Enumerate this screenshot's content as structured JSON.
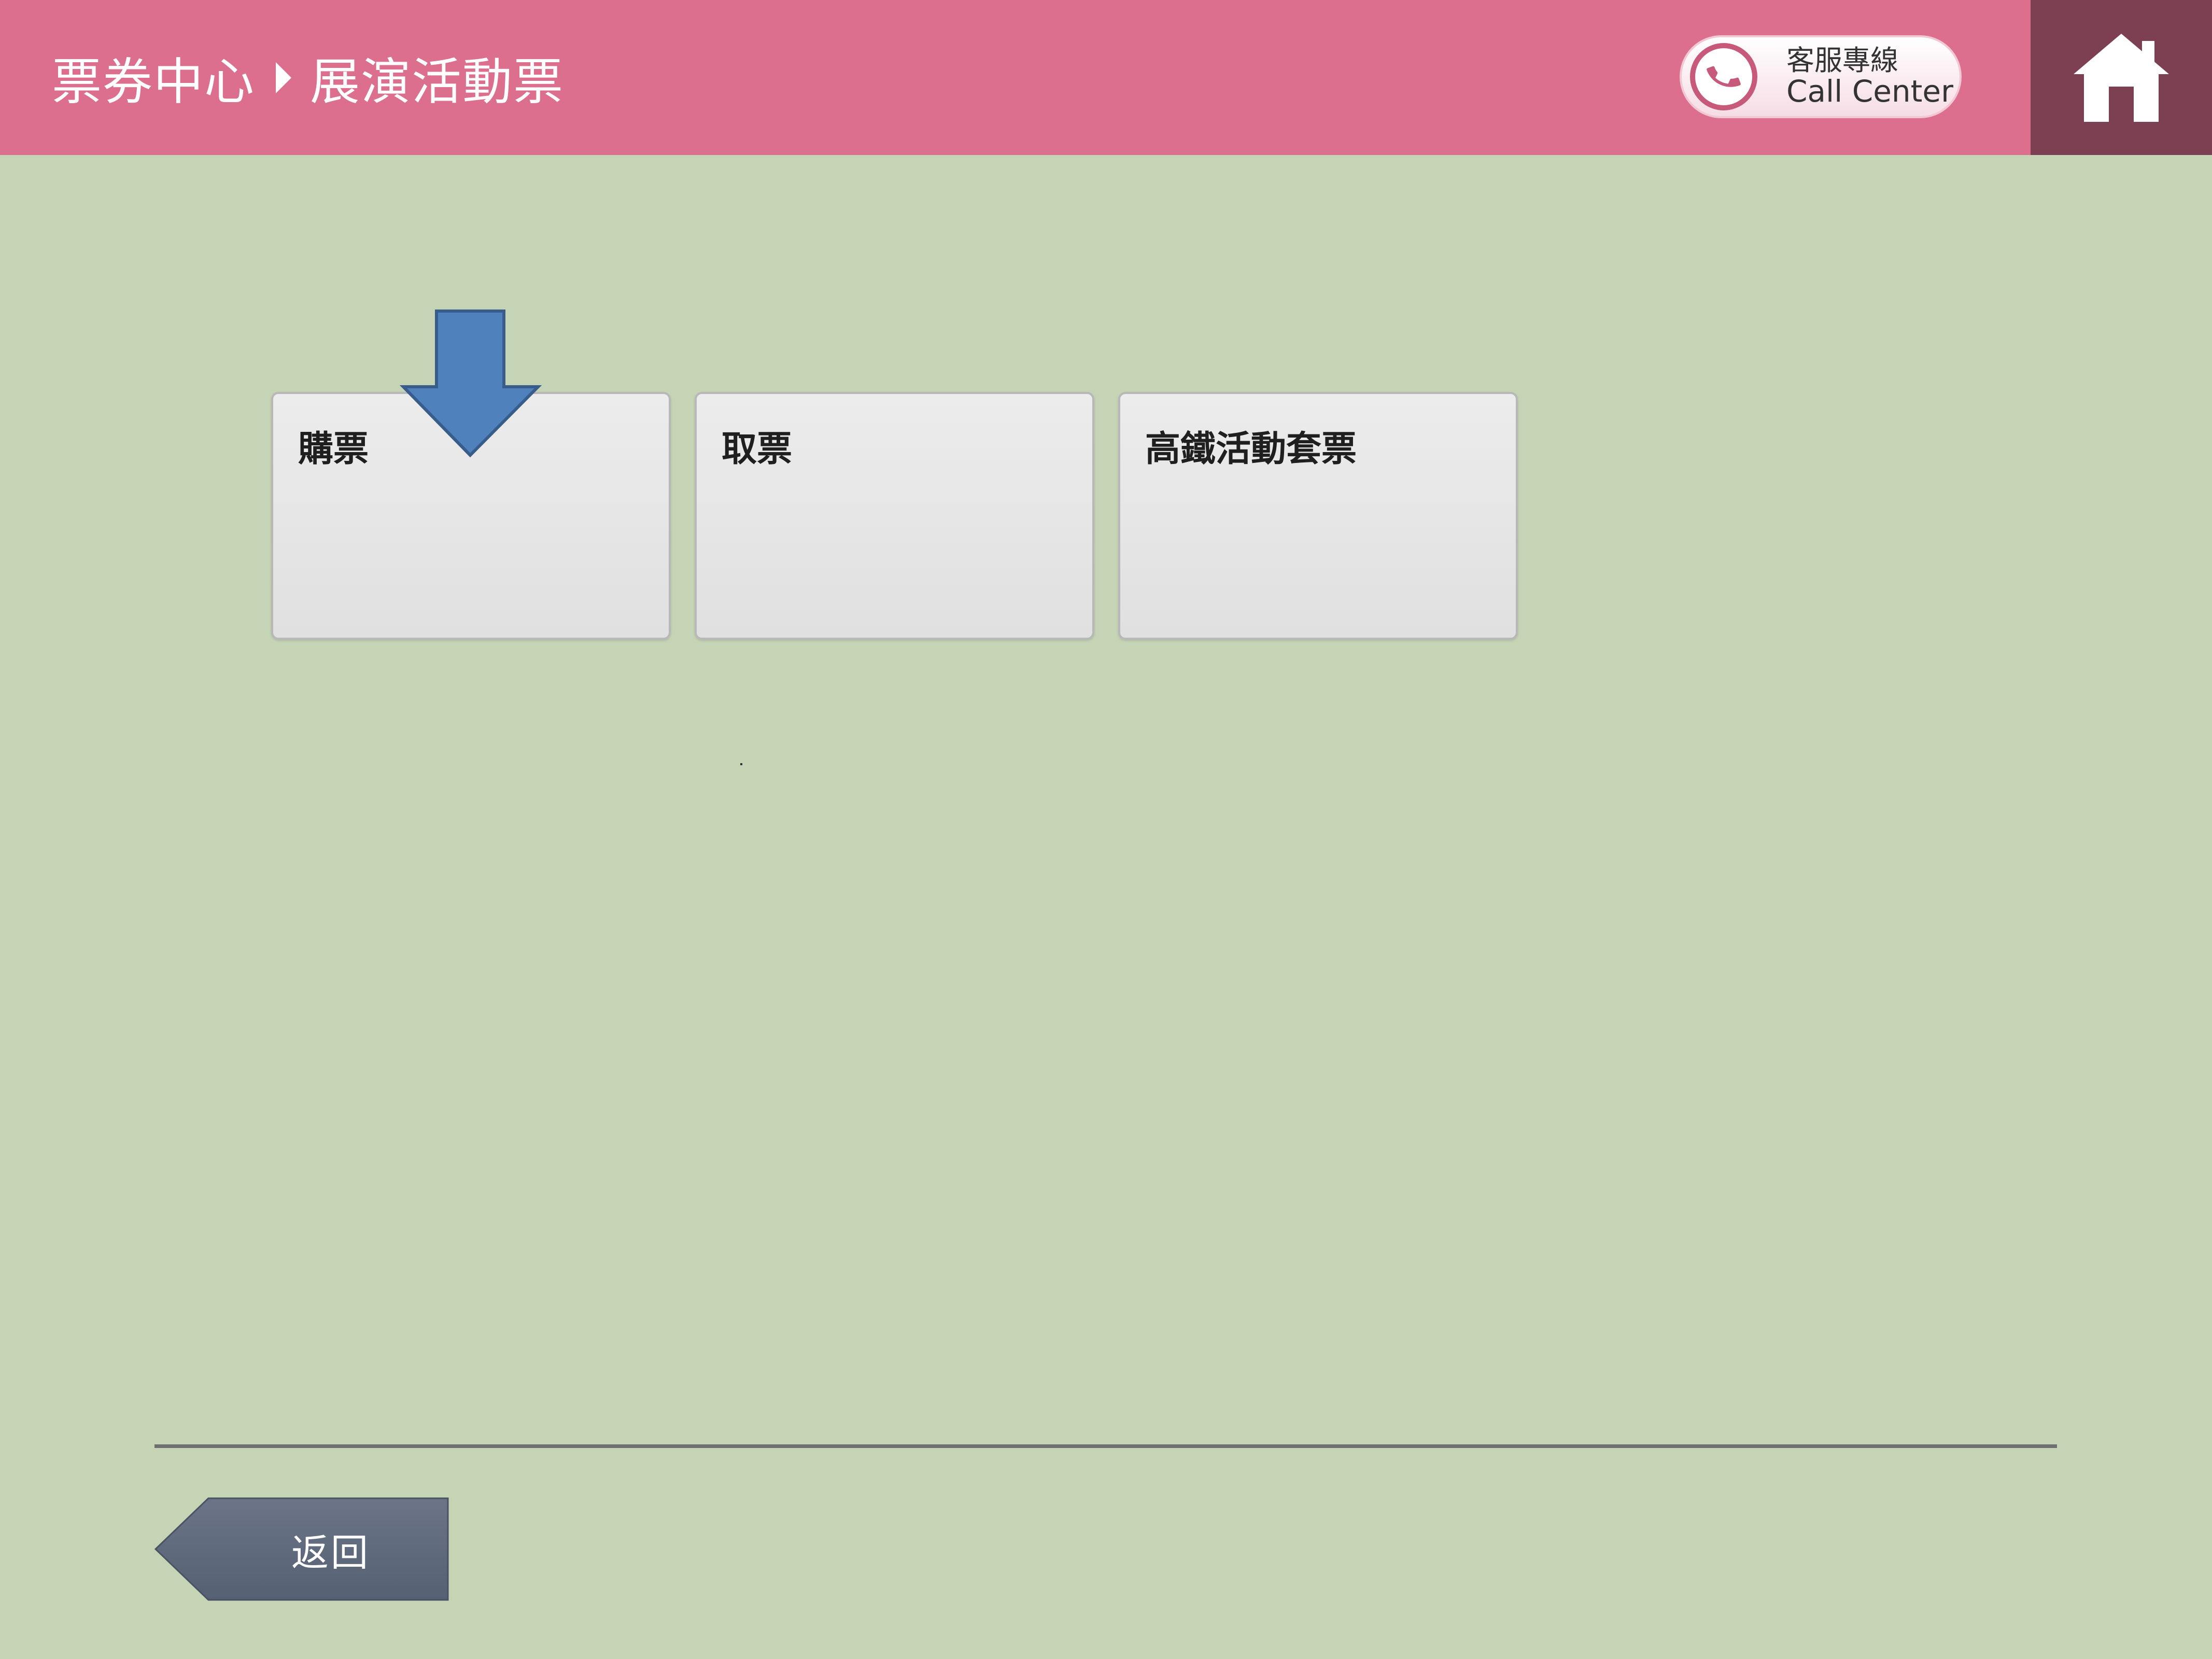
{
  "header": {
    "breadcrumb": [
      "票券中心",
      "展演活動票"
    ],
    "call_center": {
      "label_zh": "客服專線",
      "label_en": "Call Center",
      "icon": "phone-icon"
    },
    "home_icon": "home-icon",
    "colors": {
      "header_bg": "#dc6f8d",
      "home_bg": "#7d4052",
      "page_bg": "#c6d4b6"
    }
  },
  "main": {
    "tiles": [
      {
        "label": "購票"
      },
      {
        "label": "取票"
      },
      {
        "label": "高鐵活動套票"
      }
    ],
    "indicator_icon": "down-arrow-icon",
    "indicator_color": "#4f81bd"
  },
  "footer": {
    "back_label": "返回",
    "back_color": "#5c6678"
  }
}
